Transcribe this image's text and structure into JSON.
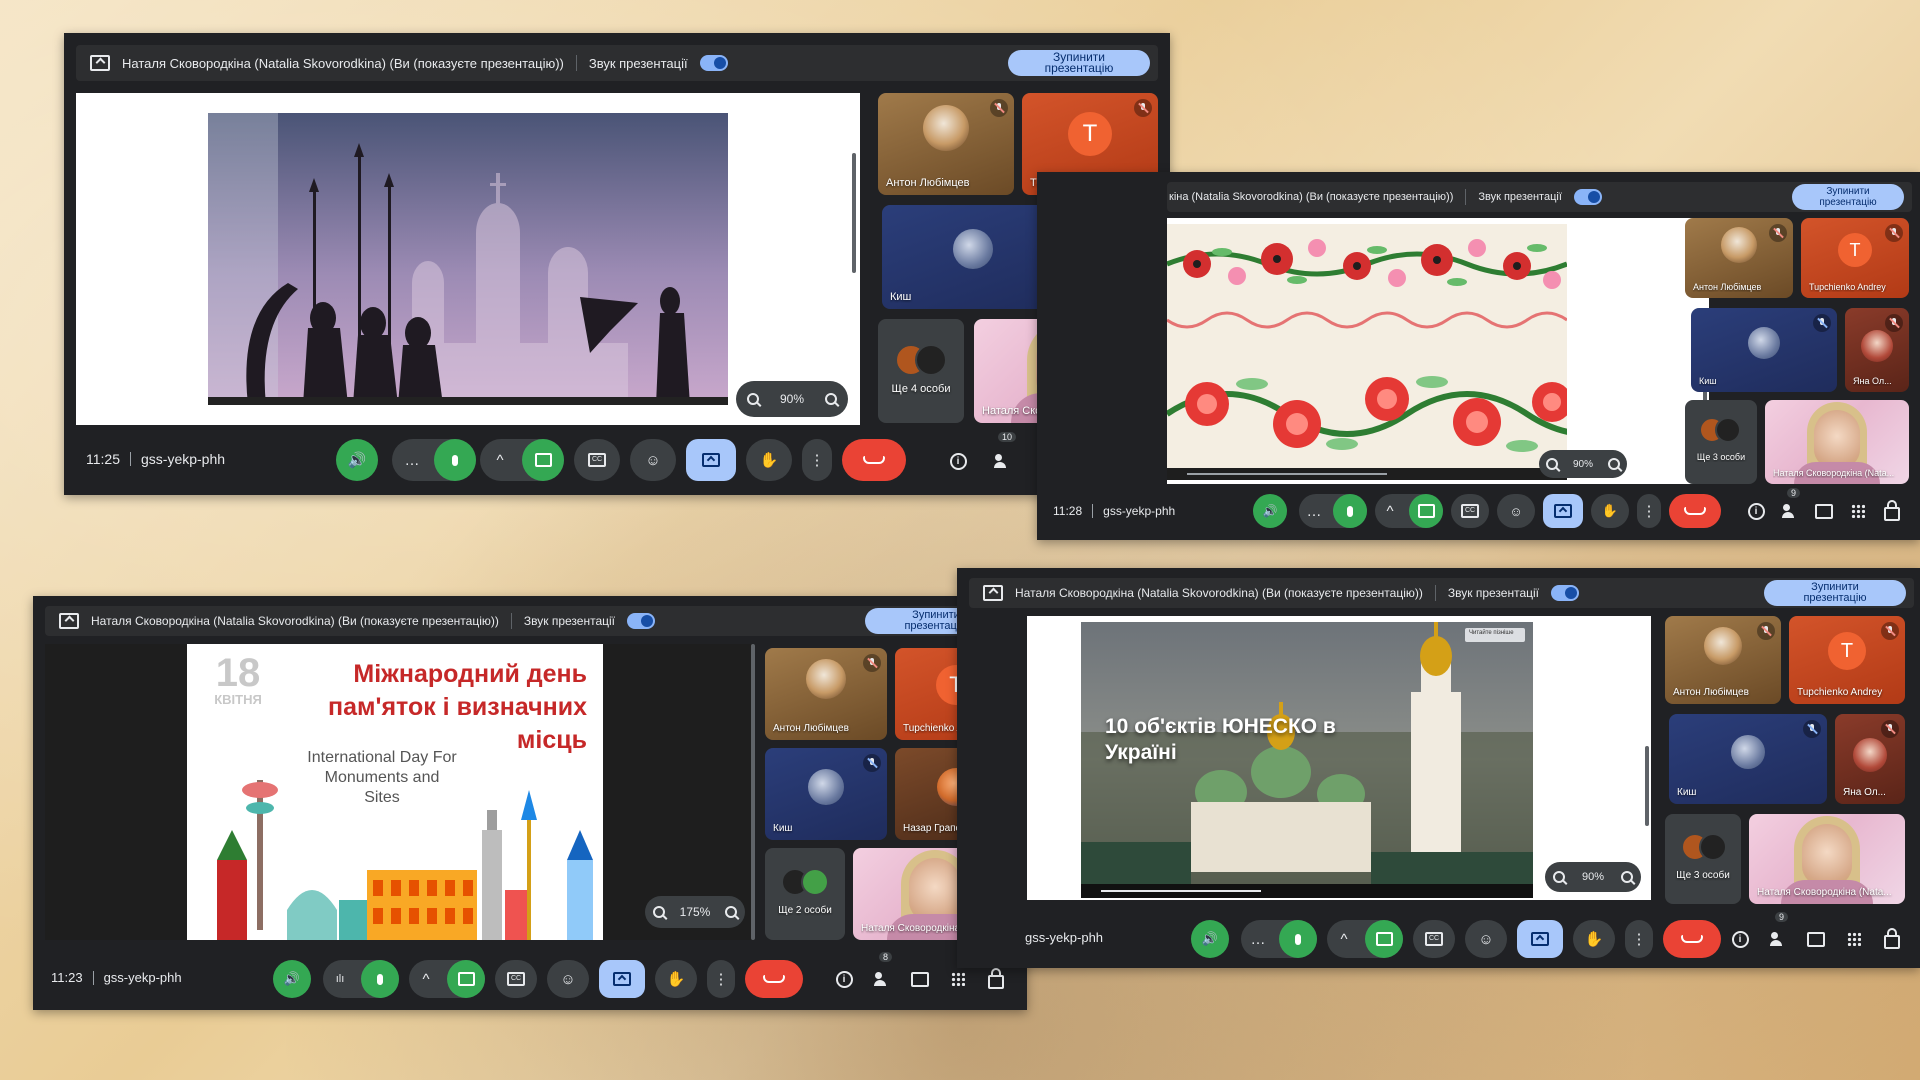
{
  "presenter_bar": {
    "title": "Наталя Сковородкіна (Natalia Skovorodkina) (Ви (показуєте презентацію))",
    "title_short": "кіна (Natalia Skovorodkina) (Ви (показуєте презентацію))",
    "title_tr": "Наталя Сковородкіна (Natalia Skovorodkina) (Ви (показуєте презентацію))",
    "sound_label": "Звук презентації",
    "stop_label": "Зупинити презентацію"
  },
  "meeting_code": "gss-yekp-phh",
  "participants": {
    "anton": "Антон Любімцев",
    "andrey": "Tupchienko Andrey",
    "andrey_initial": "T",
    "kish": "Киш",
    "yana": "Яна Ол...",
    "nazar": "Назар Грапов",
    "self": "Наталя Сковородкіна (Nata...",
    "more_4": "Ще 4 особи",
    "more_3": "Ще 3 особи",
    "more_2": "Ще 2 особи"
  },
  "controls": {
    "more": "…",
    "chevron": "^",
    "emoji": "☺",
    "hand": "✋",
    "kebab": "⋮"
  },
  "screens": {
    "tl": {
      "time": "11:25",
      "zoom": "90%",
      "people_count": "10"
    },
    "tr": {
      "time": "11:28",
      "zoom": "90%",
      "people_count": "9"
    },
    "bl": {
      "time": "11:23",
      "zoom": "175%",
      "people_count": "8"
    },
    "br": {
      "time": "",
      "zoom": "90%",
      "people_count": "9"
    }
  },
  "slides": {
    "monuments": {
      "day": "18",
      "month": "КВІТНЯ",
      "title_uk": "Міжнародний день пам'яток і визначних місць",
      "title_en": "International Day For Monuments and Sites"
    },
    "unesco": {
      "title": "10 об'єктів ЮНЕСКО в Україні",
      "watch_later": "Читайте пізніше"
    }
  },
  "colors": {
    "meet_bg": "#202124",
    "green": "#34a853",
    "red": "#ea4335",
    "accent_blue": "#a8c7fa",
    "slide_red": "#c62828"
  },
  "icons": [
    "present-icon",
    "volume-icon",
    "mic-icon",
    "camera-icon",
    "captions-icon",
    "emoji-icon",
    "share-screen-icon",
    "raise-hand-icon",
    "more-vert-icon",
    "end-call-icon",
    "info-icon",
    "people-icon",
    "chat-icon",
    "apps-icon",
    "host-controls-icon",
    "zoom-in-icon",
    "zoom-out-icon",
    "mic-off-icon"
  ]
}
